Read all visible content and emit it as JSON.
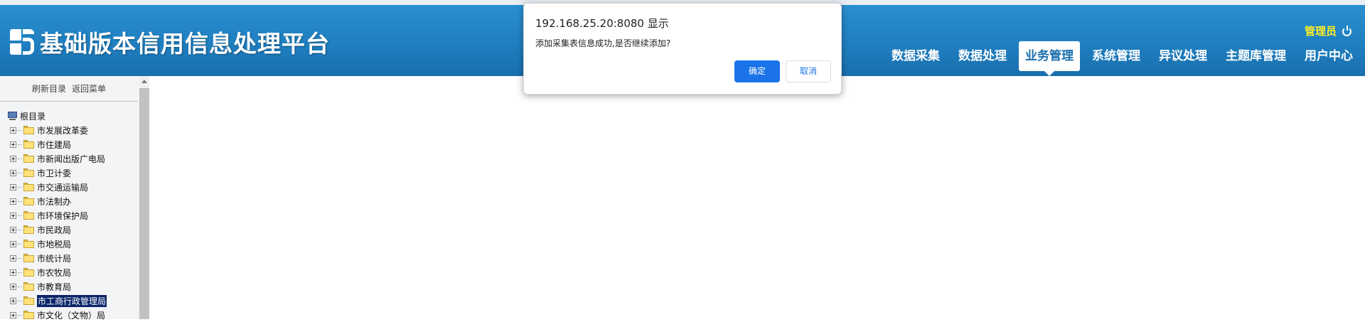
{
  "header": {
    "title": "基础版本信用信息处理平台",
    "user_name": "管理员",
    "nav": [
      {
        "label": "数据采集",
        "active": false
      },
      {
        "label": "数据处理",
        "active": false
      },
      {
        "label": "业务管理",
        "active": true
      },
      {
        "label": "系统管理",
        "active": false
      },
      {
        "label": "异议处理",
        "active": false
      },
      {
        "label": "主题库管理",
        "active": false
      },
      {
        "label": "用户中心",
        "active": false
      }
    ]
  },
  "sidebar": {
    "refresh_label": "刷新目录",
    "back_label": "返回菜单",
    "root_label": "根目录",
    "items": [
      {
        "label": "市发展改革委"
      },
      {
        "label": "市住建局"
      },
      {
        "label": "市新闻出版广电局"
      },
      {
        "label": "市卫计委"
      },
      {
        "label": "市交通运输局"
      },
      {
        "label": "市法制办"
      },
      {
        "label": "市环境保护局"
      },
      {
        "label": "市民政局"
      },
      {
        "label": "市地税局"
      },
      {
        "label": "市统计局"
      },
      {
        "label": "市农牧局"
      },
      {
        "label": "市教育局"
      },
      {
        "label": "市工商行政管理局",
        "selected": true
      },
      {
        "label": "市文化（文物）局"
      }
    ]
  },
  "dialog": {
    "title": "192.168.25.20:8080 显示",
    "message": "添加采集表信息成功,是否继续添加?",
    "ok_label": "确定",
    "cancel_label": "取消"
  },
  "colors": {
    "header_blue": "#1f7fc0",
    "user_yellow": "#ffee22",
    "dialog_button_blue": "#1a73e8",
    "selected_bg": "#0a246a"
  }
}
